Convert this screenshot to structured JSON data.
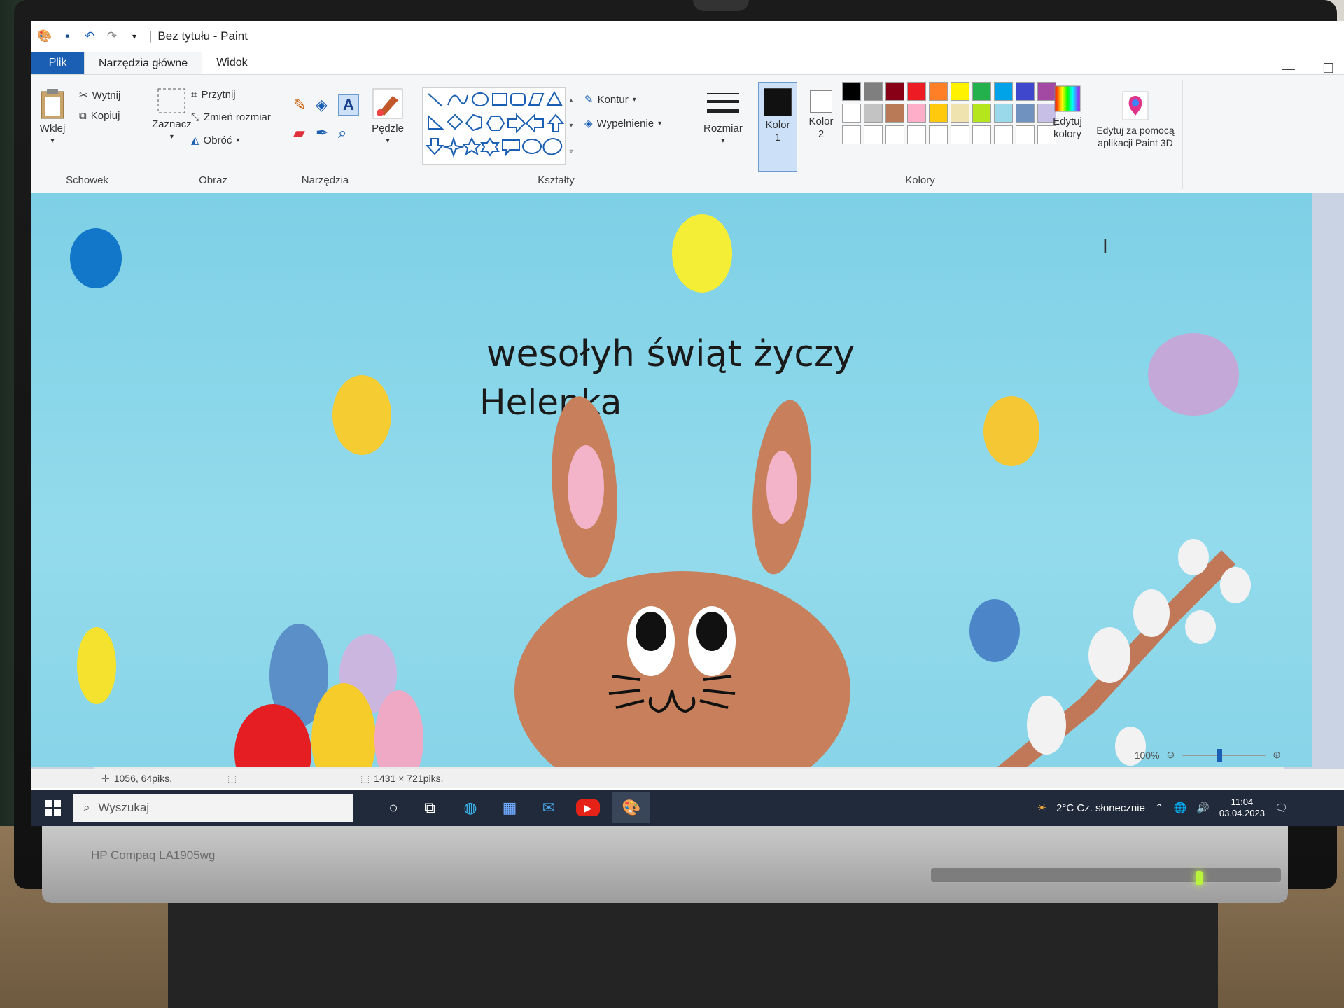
{
  "window": {
    "title": "Bez tytułu - Paint"
  },
  "tabs": [
    {
      "label": "Plik"
    },
    {
      "label": "Narzędzia główne"
    },
    {
      "label": "Widok"
    }
  ],
  "ribbon": {
    "clipboard": {
      "paste": "Wklej",
      "cut": "Wytnij",
      "copy": "Kopiuj",
      "group": "Schowek"
    },
    "image": {
      "select": "Zaznacz",
      "crop": "Przytnij",
      "resize": "Zmień rozmiar",
      "rotate": "Obróć",
      "group": "Obraz"
    },
    "tools": {
      "group": "Narzędzia"
    },
    "brushes": {
      "label": "Pędzle"
    },
    "shapes": {
      "outline": "Kontur",
      "fill": "Wypełnienie",
      "group": "Kształty"
    },
    "size": {
      "label": "Rozmiar"
    },
    "colors": {
      "color1": "Kolor 1",
      "color2": "Kolor 2",
      "edit": "Edytuj kolory",
      "group": "Kolory",
      "color1_value": "#111111",
      "color2_value": "#ffffff",
      "palette": [
        "#000000",
        "#7f7f7f",
        "#880015",
        "#ed1c24",
        "#ff7f27",
        "#fff200",
        "#22b14c",
        "#00a2e8",
        "#3f48cc",
        "#a349a4",
        "#ffffff",
        "#c3c3c3",
        "#b97a57",
        "#ffaec9",
        "#ffc90e",
        "#efe4b0",
        "#b5e61d",
        "#99d9ea",
        "#7092be",
        "#c8bfe7",
        "#ffffff",
        "#ffffff",
        "#ffffff",
        "#ffffff",
        "#ffffff",
        "#ffffff",
        "#ffffff",
        "#ffffff",
        "#ffffff",
        "#ffffff"
      ]
    },
    "paint3d": {
      "label": "Edytuj za pomocą aplikacji Paint 3D"
    }
  },
  "canvas": {
    "text_line1": "wesołyh świąt życzy",
    "text_line2": "Helenka"
  },
  "status": {
    "cursor_pos": "1056, 64piks.",
    "image_size": "1431 × 721piks.",
    "zoom": "100%"
  },
  "taskbar": {
    "search_placeholder": "Wyszukaj",
    "weather": "2°C Cz. słonecznie",
    "time": "11:04",
    "date": "03.04.2023"
  },
  "monitor": {
    "brand": "HP Compaq LA1905wg"
  }
}
